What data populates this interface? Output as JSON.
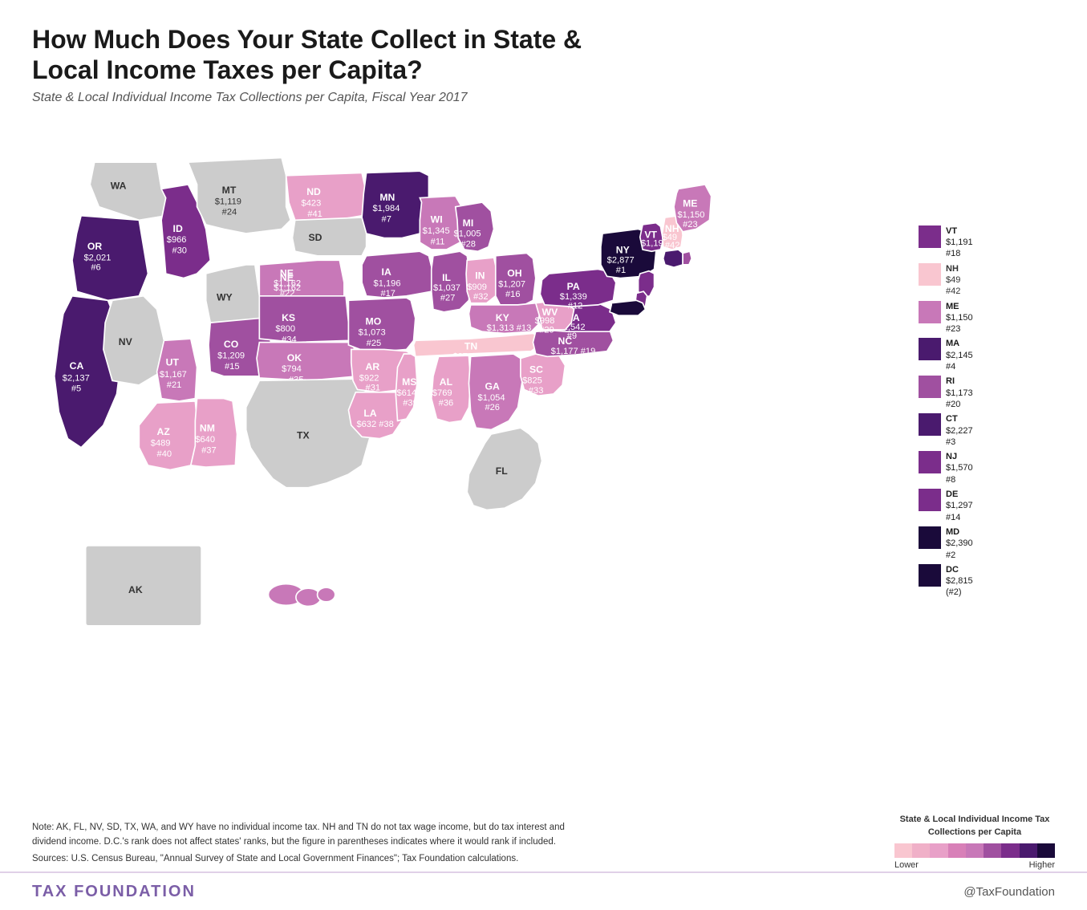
{
  "title": "How Much Does Your State Collect in State & Local Income Taxes per Capita?",
  "subtitle": "State & Local Individual Income Tax Collections per Capita, Fiscal Year 2017",
  "footer_note": "Note: AK, FL, NV, SD, TX, WA, and WY have no individual income tax. NH and TN do not tax wage income, but do tax interest and dividend income. D.C.'s rank does not affect states' ranks, but the figure in parentheses indicates where it would rank if included.",
  "footer_sources": "Sources: U.S. Census Bureau, \"Annual Survey of State and Local Government Finances\"; Tax Foundation calculations.",
  "footer_brand": "TAX FOUNDATION",
  "footer_twitter": "@TaxFoundation",
  "legend_title": "State & Local Individual Income Tax Collections per Capita",
  "legend_lower": "Lower",
  "legend_higher": "Higher",
  "colors": {
    "no_tax": "#cccccc",
    "tier1": "#f9c6d0",
    "tier2": "#e8a0c8",
    "tier3": "#c878b8",
    "tier4": "#a050a0",
    "tier5": "#7b2d8b",
    "tier6": "#4a1a6e",
    "tier7": "#1a0a3a",
    "nh_tn": "#f5b8c8"
  },
  "right_states": [
    {
      "abbr": "MA",
      "value": "$2,145",
      "rank": "#4",
      "color": "#4a1a6e"
    },
    {
      "abbr": "RI",
      "value": "$1,173",
      "rank": "#20",
      "color": "#a050a0"
    },
    {
      "abbr": "CT",
      "value": "$2,227",
      "rank": "#3",
      "color": "#4a1a6e"
    },
    {
      "abbr": "NJ",
      "value": "$1,570",
      "rank": "#8",
      "color": "#7b2d8b"
    },
    {
      "abbr": "DE",
      "value": "$1,297",
      "rank": "#14",
      "color": "#7b2d8b"
    },
    {
      "abbr": "MD",
      "value": "$2,390",
      "rank": "#2",
      "color": "#1a0a3a"
    },
    {
      "abbr": "DC",
      "value": "$2,815",
      "rank": "(#2)",
      "color": "#1a0a3a"
    }
  ]
}
